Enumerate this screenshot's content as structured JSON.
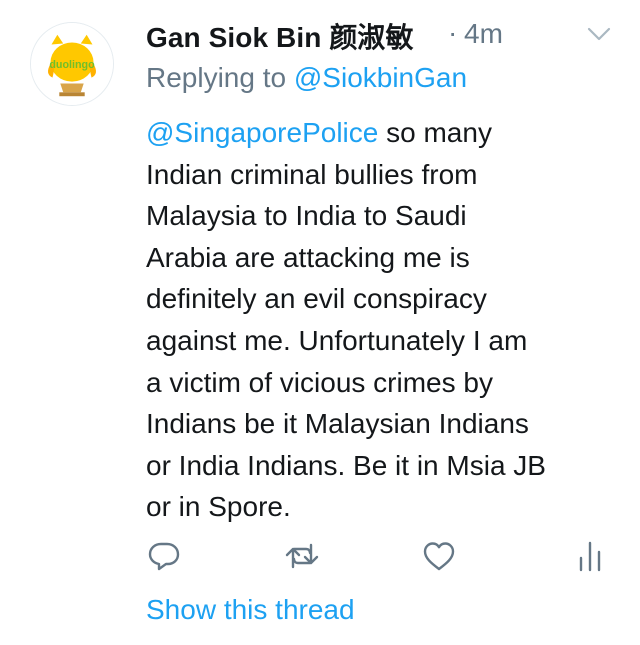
{
  "tweet": {
    "author_name": "Gan Siok Bin 颜淑敏",
    "separator": "·",
    "timestamp": "4m",
    "replying_prefix": "Replying to ",
    "replying_handle": "@SiokbinGan",
    "avatar_logo_text": "duolingo",
    "body_mention": "@SingaporePolice",
    "body_lines": [
      " so many",
      "Indian criminal bullies from",
      "Malaysia to India to Saudi",
      "Arabia are attacking me is",
      "definitely an evil conspiracy",
      "against me. Unfortunately I am",
      "a victim of vicious crimes by",
      "Indians be it Malaysian Indians",
      "or India Indians. Be it in Msia JB",
      "or in Spore."
    ],
    "show_thread_label": "Show this thread"
  },
  "actions": {
    "reply_icon": "reply-icon",
    "retweet_icon": "retweet-icon",
    "like_icon": "heart-icon",
    "analytics_icon": "analytics-icon"
  },
  "colors": {
    "link_blue": "#1da1f2",
    "secondary_gray": "#657786",
    "text_dark": "#14171a",
    "icon_gray": "#657786",
    "duolingo_green": "#8ec63f",
    "owl_yellow": "#ffc800",
    "trophy_gold": "#d9a54a"
  }
}
